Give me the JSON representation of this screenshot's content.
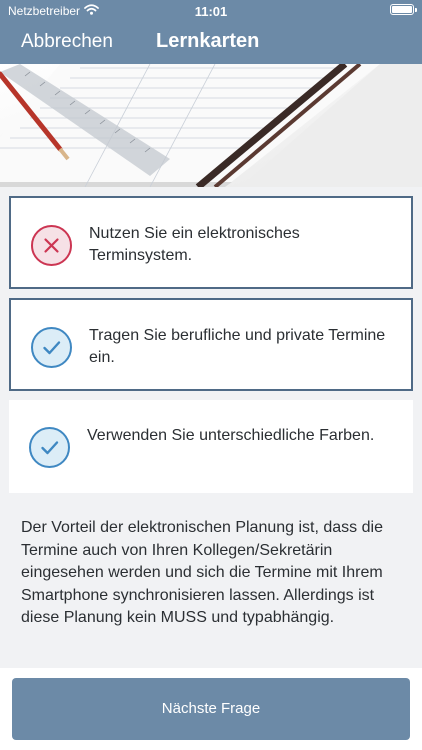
{
  "status_bar": {
    "carrier": "Netzbetreiber",
    "time": "11:01"
  },
  "nav": {
    "cancel_label": "Abbrechen",
    "title": "Lernkarten"
  },
  "answers": [
    {
      "text": "Nutzen Sie ein elektronisches Terminsystem.",
      "state": "wrong",
      "icon": "x-circle-icon"
    },
    {
      "text": "Tragen Sie berufliche und private Termine ein.",
      "state": "correct",
      "icon": "check-circle-icon"
    },
    {
      "text": "Verwenden Sie unterschiedliche Farben.",
      "state": "correct",
      "icon": "check-circle-icon"
    }
  ],
  "explanation": "Der Vorteil der elektronischen Planung ist, dass die Termine auch von Ihren Kollegen/Sekretärin eingesehen werden und sich die Termine mit Ihrem Smartphone synchronisieren lassen. Allerdings ist diese Planung kein MUSS und typabhängig.",
  "next_button_label": "Nächste Frage",
  "colors": {
    "nav_background": "#6c8aa7",
    "wrong": "#cc3552",
    "correct": "#3f88c2",
    "card_border": "#4f6a86"
  }
}
